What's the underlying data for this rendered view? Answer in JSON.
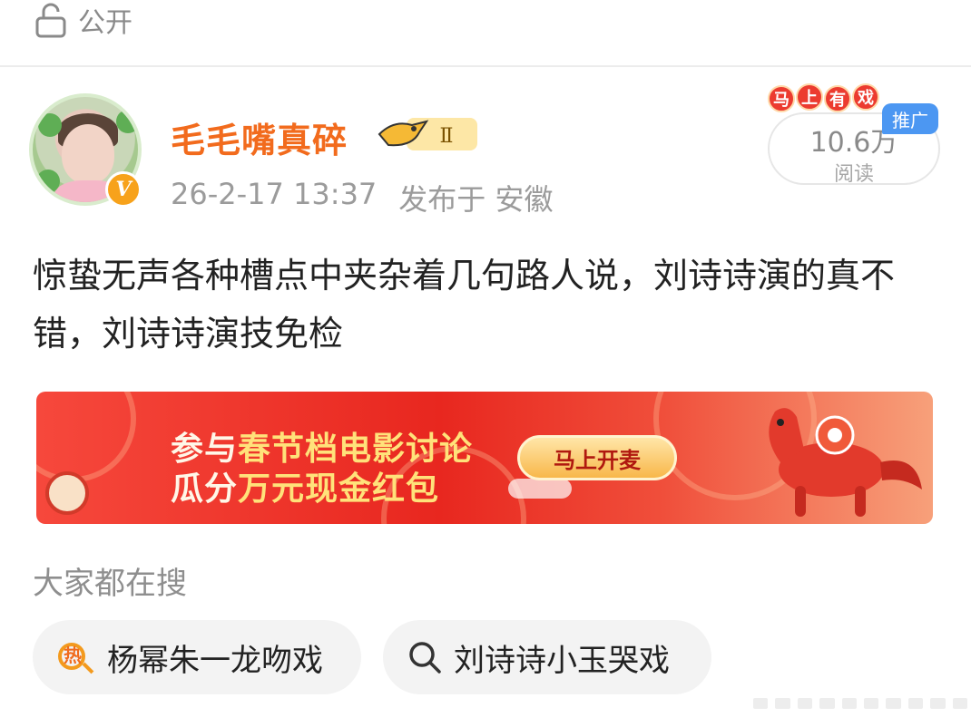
{
  "privacy": {
    "label": "公开"
  },
  "author": {
    "name": "毛毛嘴真碎",
    "level_badge": "Ⅱ",
    "verified_badge": "V",
    "timestamp": "26-2-17 13:37",
    "location": "发布于 安徽"
  },
  "stats": {
    "views": "10.6万",
    "views_label": "阅读",
    "promo_tag": [
      "马",
      "上",
      "有",
      "戏"
    ],
    "ad_badge": "推广"
  },
  "post": {
    "text": "惊蛰无声各种槽点中夹杂着几句路人说，刘诗诗演的真不错，刘诗诗演技免检"
  },
  "banner": {
    "line1_prefix": "参与",
    "line1_highlight": "春节档电影讨论",
    "line2_prefix": "瓜分",
    "line2_highlight": "万元现金红包",
    "cta": "马上开麦"
  },
  "search": {
    "title": "大家都在搜",
    "items": [
      {
        "label": "杨幂朱一龙吻戏",
        "icon": "hot-search-icon",
        "hot_mark": "热"
      },
      {
        "label": "刘诗诗小玉哭戏",
        "icon": "search-icon"
      }
    ]
  },
  "colors": {
    "username": "#f26b1d",
    "ad_badge": "#4c97f2",
    "banner_red": "#e8271f",
    "hot_icon": "#f39a1d"
  }
}
